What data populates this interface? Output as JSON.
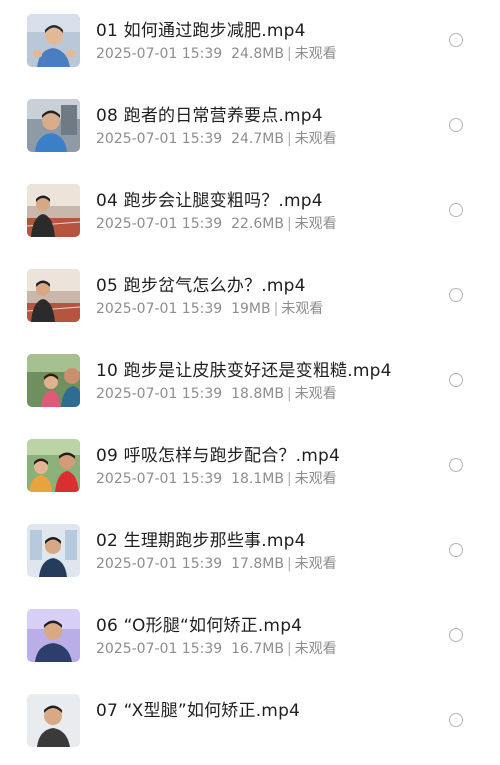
{
  "videos": [
    {
      "title": "01  如何通过跑步减肥.mp4",
      "date": "2025-07-01 15:39",
      "size": "24.8MB",
      "status": "未观看",
      "thumb": "thumb-man-lab"
    },
    {
      "title": "08  跑者的日常营养要点.mp4",
      "date": "2025-07-01 15:39",
      "size": "24.7MB",
      "status": "未观看",
      "thumb": "thumb-man-gym"
    },
    {
      "title": "04  跑步会让腿变粗吗？.mp4",
      "date": "2025-07-01 15:39",
      "size": "22.6MB",
      "status": "未观看",
      "thumb": "thumb-man-track"
    },
    {
      "title": "05  跑步岔气怎么办？.mp4",
      "date": "2025-07-01 15:39",
      "size": "19MB",
      "status": "未观看",
      "thumb": "thumb-man-track"
    },
    {
      "title": "10  跑步是让皮肤变好还是变粗糙.mp4",
      "date": "2025-07-01 15:39",
      "size": "18.8MB",
      "status": "未观看",
      "thumb": "thumb-runners"
    },
    {
      "title": "09  呼吸怎样与跑步配合？.mp4",
      "date": "2025-07-01 15:39",
      "size": "18.1MB",
      "status": "未观看",
      "thumb": "thumb-runners-china"
    },
    {
      "title": "02  生理期跑步那些事.mp4",
      "date": "2025-07-01 15:39",
      "size": "17.8MB",
      "status": "未观看",
      "thumb": "thumb-man-board"
    },
    {
      "title": "06 “O形腿“如何矫正.mp4",
      "date": "2025-07-01 15:39",
      "size": "16.7MB",
      "status": "未观看",
      "thumb": "thumb-man-purple"
    },
    {
      "title": "07 “X型腿”如何矫正.mp4",
      "date": "2025-07-01 15:39",
      "size": "",
      "status": "",
      "thumb": "thumb-man-white"
    }
  ]
}
